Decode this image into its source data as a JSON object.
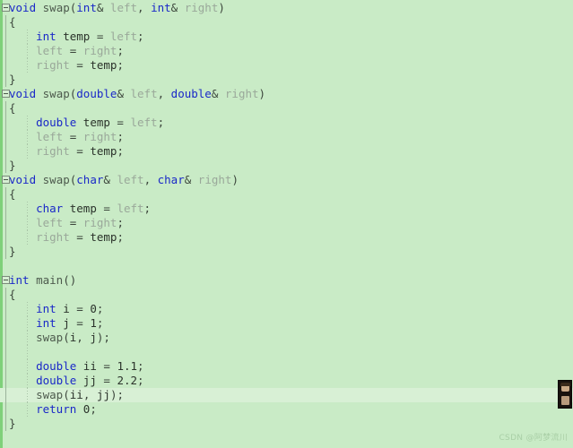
{
  "editor": {
    "language": "cpp",
    "background_color": "#c9ebc6",
    "current_line_color": "#d8f0d5",
    "change_bar_color": "#7fd07a",
    "keyword_color": "#1a28c8",
    "identifier_dim_color": "#9aa89a",
    "function_color": "#4d5a4d"
  },
  "watermark": {
    "text": "CSDN @阿梦流川"
  },
  "badge": {
    "name": "avatar-badge"
  },
  "lines": [
    {
      "n": 1,
      "fold": true,
      "guide": false,
      "indent": false,
      "current": false,
      "tokens": [
        {
          "t": "void",
          "c": "kw"
        },
        {
          "t": " ",
          "c": "pun"
        },
        {
          "t": "swap",
          "c": "fn"
        },
        {
          "t": "(",
          "c": "pun"
        },
        {
          "t": "int",
          "c": "kw"
        },
        {
          "t": "& ",
          "c": "pun"
        },
        {
          "t": "left",
          "c": "var"
        },
        {
          "t": ", ",
          "c": "pun"
        },
        {
          "t": "int",
          "c": "kw"
        },
        {
          "t": "& ",
          "c": "pun"
        },
        {
          "t": "right",
          "c": "var"
        },
        {
          "t": ")",
          "c": "pun"
        }
      ]
    },
    {
      "n": 2,
      "fold": false,
      "guide": true,
      "indent": false,
      "current": false,
      "tokens": [
        {
          "t": "{",
          "c": "pun"
        }
      ]
    },
    {
      "n": 3,
      "fold": false,
      "guide": true,
      "indent": true,
      "current": false,
      "tokens": [
        {
          "t": "    ",
          "c": "pun"
        },
        {
          "t": "int",
          "c": "kw"
        },
        {
          "t": " ",
          "c": "pun"
        },
        {
          "t": "temp",
          "c": "id"
        },
        {
          "t": " = ",
          "c": "pun"
        },
        {
          "t": "left",
          "c": "var"
        },
        {
          "t": ";",
          "c": "pun"
        }
      ]
    },
    {
      "n": 4,
      "fold": false,
      "guide": true,
      "indent": true,
      "current": false,
      "tokens": [
        {
          "t": "    ",
          "c": "pun"
        },
        {
          "t": "left",
          "c": "var"
        },
        {
          "t": " = ",
          "c": "pun"
        },
        {
          "t": "right",
          "c": "var"
        },
        {
          "t": ";",
          "c": "pun"
        }
      ]
    },
    {
      "n": 5,
      "fold": false,
      "guide": true,
      "indent": true,
      "current": false,
      "tokens": [
        {
          "t": "    ",
          "c": "pun"
        },
        {
          "t": "right",
          "c": "var"
        },
        {
          "t": " = ",
          "c": "pun"
        },
        {
          "t": "temp",
          "c": "id"
        },
        {
          "t": ";",
          "c": "pun"
        }
      ]
    },
    {
      "n": 6,
      "fold": false,
      "guide": true,
      "indent": false,
      "current": false,
      "tokens": [
        {
          "t": "}",
          "c": "pun"
        }
      ]
    },
    {
      "n": 7,
      "fold": true,
      "guide": false,
      "indent": false,
      "current": false,
      "tokens": [
        {
          "t": "void",
          "c": "kw"
        },
        {
          "t": " ",
          "c": "pun"
        },
        {
          "t": "swap",
          "c": "fn"
        },
        {
          "t": "(",
          "c": "pun"
        },
        {
          "t": "double",
          "c": "kw"
        },
        {
          "t": "& ",
          "c": "pun"
        },
        {
          "t": "left",
          "c": "var"
        },
        {
          "t": ", ",
          "c": "pun"
        },
        {
          "t": "double",
          "c": "kw"
        },
        {
          "t": "& ",
          "c": "pun"
        },
        {
          "t": "right",
          "c": "var"
        },
        {
          "t": ")",
          "c": "pun"
        }
      ]
    },
    {
      "n": 8,
      "fold": false,
      "guide": true,
      "indent": false,
      "current": false,
      "tokens": [
        {
          "t": "{",
          "c": "pun"
        }
      ]
    },
    {
      "n": 9,
      "fold": false,
      "guide": true,
      "indent": true,
      "current": false,
      "tokens": [
        {
          "t": "    ",
          "c": "pun"
        },
        {
          "t": "double",
          "c": "kw"
        },
        {
          "t": " ",
          "c": "pun"
        },
        {
          "t": "temp",
          "c": "id"
        },
        {
          "t": " = ",
          "c": "pun"
        },
        {
          "t": "left",
          "c": "var"
        },
        {
          "t": ";",
          "c": "pun"
        }
      ]
    },
    {
      "n": 10,
      "fold": false,
      "guide": true,
      "indent": true,
      "current": false,
      "tokens": [
        {
          "t": "    ",
          "c": "pun"
        },
        {
          "t": "left",
          "c": "var"
        },
        {
          "t": " = ",
          "c": "pun"
        },
        {
          "t": "right",
          "c": "var"
        },
        {
          "t": ";",
          "c": "pun"
        }
      ]
    },
    {
      "n": 11,
      "fold": false,
      "guide": true,
      "indent": true,
      "current": false,
      "tokens": [
        {
          "t": "    ",
          "c": "pun"
        },
        {
          "t": "right",
          "c": "var"
        },
        {
          "t": " = ",
          "c": "pun"
        },
        {
          "t": "temp",
          "c": "id"
        },
        {
          "t": ";",
          "c": "pun"
        }
      ]
    },
    {
      "n": 12,
      "fold": false,
      "guide": true,
      "indent": false,
      "current": false,
      "tokens": [
        {
          "t": "}",
          "c": "pun"
        }
      ]
    },
    {
      "n": 13,
      "fold": true,
      "guide": false,
      "indent": false,
      "current": false,
      "tokens": [
        {
          "t": "void",
          "c": "kw"
        },
        {
          "t": " ",
          "c": "pun"
        },
        {
          "t": "swap",
          "c": "fn"
        },
        {
          "t": "(",
          "c": "pun"
        },
        {
          "t": "char",
          "c": "kw"
        },
        {
          "t": "& ",
          "c": "pun"
        },
        {
          "t": "left",
          "c": "var"
        },
        {
          "t": ", ",
          "c": "pun"
        },
        {
          "t": "char",
          "c": "kw"
        },
        {
          "t": "& ",
          "c": "pun"
        },
        {
          "t": "right",
          "c": "var"
        },
        {
          "t": ")",
          "c": "pun"
        }
      ]
    },
    {
      "n": 14,
      "fold": false,
      "guide": true,
      "indent": false,
      "current": false,
      "tokens": [
        {
          "t": "{",
          "c": "pun"
        }
      ]
    },
    {
      "n": 15,
      "fold": false,
      "guide": true,
      "indent": true,
      "current": false,
      "tokens": [
        {
          "t": "    ",
          "c": "pun"
        },
        {
          "t": "char",
          "c": "kw"
        },
        {
          "t": " ",
          "c": "pun"
        },
        {
          "t": "temp",
          "c": "id"
        },
        {
          "t": " = ",
          "c": "pun"
        },
        {
          "t": "left",
          "c": "var"
        },
        {
          "t": ";",
          "c": "pun"
        }
      ]
    },
    {
      "n": 16,
      "fold": false,
      "guide": true,
      "indent": true,
      "current": false,
      "tokens": [
        {
          "t": "    ",
          "c": "pun"
        },
        {
          "t": "left",
          "c": "var"
        },
        {
          "t": " = ",
          "c": "pun"
        },
        {
          "t": "right",
          "c": "var"
        },
        {
          "t": ";",
          "c": "pun"
        }
      ]
    },
    {
      "n": 17,
      "fold": false,
      "guide": true,
      "indent": true,
      "current": false,
      "tokens": [
        {
          "t": "    ",
          "c": "pun"
        },
        {
          "t": "right",
          "c": "var"
        },
        {
          "t": " = ",
          "c": "pun"
        },
        {
          "t": "temp",
          "c": "id"
        },
        {
          "t": ";",
          "c": "pun"
        }
      ]
    },
    {
      "n": 18,
      "fold": false,
      "guide": true,
      "indent": false,
      "current": false,
      "tokens": [
        {
          "t": "}",
          "c": "pun"
        }
      ]
    },
    {
      "n": 19,
      "fold": false,
      "guide": false,
      "indent": false,
      "current": false,
      "tokens": []
    },
    {
      "n": 20,
      "fold": true,
      "guide": false,
      "indent": false,
      "current": false,
      "tokens": [
        {
          "t": "int",
          "c": "kw"
        },
        {
          "t": " ",
          "c": "pun"
        },
        {
          "t": "main",
          "c": "fn"
        },
        {
          "t": "()",
          "c": "pun"
        }
      ]
    },
    {
      "n": 21,
      "fold": false,
      "guide": true,
      "indent": false,
      "current": false,
      "tokens": [
        {
          "t": "{",
          "c": "pun"
        }
      ]
    },
    {
      "n": 22,
      "fold": false,
      "guide": true,
      "indent": true,
      "current": false,
      "tokens": [
        {
          "t": "    ",
          "c": "pun"
        },
        {
          "t": "int",
          "c": "kw"
        },
        {
          "t": " ",
          "c": "pun"
        },
        {
          "t": "i",
          "c": "id"
        },
        {
          "t": " = ",
          "c": "pun"
        },
        {
          "t": "0",
          "c": "num"
        },
        {
          "t": ";",
          "c": "pun"
        }
      ]
    },
    {
      "n": 23,
      "fold": false,
      "guide": true,
      "indent": true,
      "current": false,
      "tokens": [
        {
          "t": "    ",
          "c": "pun"
        },
        {
          "t": "int",
          "c": "kw"
        },
        {
          "t": " ",
          "c": "pun"
        },
        {
          "t": "j",
          "c": "id"
        },
        {
          "t": " = ",
          "c": "pun"
        },
        {
          "t": "1",
          "c": "num"
        },
        {
          "t": ";",
          "c": "pun"
        }
      ]
    },
    {
      "n": 24,
      "fold": false,
      "guide": true,
      "indent": true,
      "current": false,
      "tokens": [
        {
          "t": "    ",
          "c": "pun"
        },
        {
          "t": "swap",
          "c": "fn"
        },
        {
          "t": "(",
          "c": "pun"
        },
        {
          "t": "i",
          "c": "id"
        },
        {
          "t": ", ",
          "c": "pun"
        },
        {
          "t": "j",
          "c": "id"
        },
        {
          "t": ");",
          "c": "pun"
        }
      ]
    },
    {
      "n": 25,
      "fold": false,
      "guide": true,
      "indent": true,
      "current": false,
      "tokens": []
    },
    {
      "n": 26,
      "fold": false,
      "guide": true,
      "indent": true,
      "current": false,
      "tokens": [
        {
          "t": "    ",
          "c": "pun"
        },
        {
          "t": "double",
          "c": "kw"
        },
        {
          "t": " ",
          "c": "pun"
        },
        {
          "t": "ii",
          "c": "id"
        },
        {
          "t": " = ",
          "c": "pun"
        },
        {
          "t": "1.1",
          "c": "num"
        },
        {
          "t": ";",
          "c": "pun"
        }
      ]
    },
    {
      "n": 27,
      "fold": false,
      "guide": true,
      "indent": true,
      "current": false,
      "tokens": [
        {
          "t": "    ",
          "c": "pun"
        },
        {
          "t": "double",
          "c": "kw"
        },
        {
          "t": " ",
          "c": "pun"
        },
        {
          "t": "jj",
          "c": "id"
        },
        {
          "t": " = ",
          "c": "pun"
        },
        {
          "t": "2.2",
          "c": "num"
        },
        {
          "t": ";",
          "c": "pun"
        }
      ]
    },
    {
      "n": 28,
      "fold": false,
      "guide": true,
      "indent": true,
      "current": true,
      "tokens": [
        {
          "t": "    ",
          "c": "pun"
        },
        {
          "t": "swap",
          "c": "fn"
        },
        {
          "t": "(",
          "c": "pun"
        },
        {
          "t": "ii",
          "c": "id"
        },
        {
          "t": ", ",
          "c": "pun"
        },
        {
          "t": "jj",
          "c": "id"
        },
        {
          "t": ");",
          "c": "pun"
        }
      ]
    },
    {
      "n": 29,
      "fold": false,
      "guide": true,
      "indent": true,
      "current": false,
      "tokens": [
        {
          "t": "    ",
          "c": "pun"
        },
        {
          "t": "return",
          "c": "kw"
        },
        {
          "t": " ",
          "c": "pun"
        },
        {
          "t": "0",
          "c": "num"
        },
        {
          "t": ";",
          "c": "pun"
        }
      ]
    },
    {
      "n": 30,
      "fold": false,
      "guide": true,
      "indent": false,
      "current": false,
      "tokens": [
        {
          "t": "}",
          "c": "pun"
        }
      ]
    }
  ]
}
